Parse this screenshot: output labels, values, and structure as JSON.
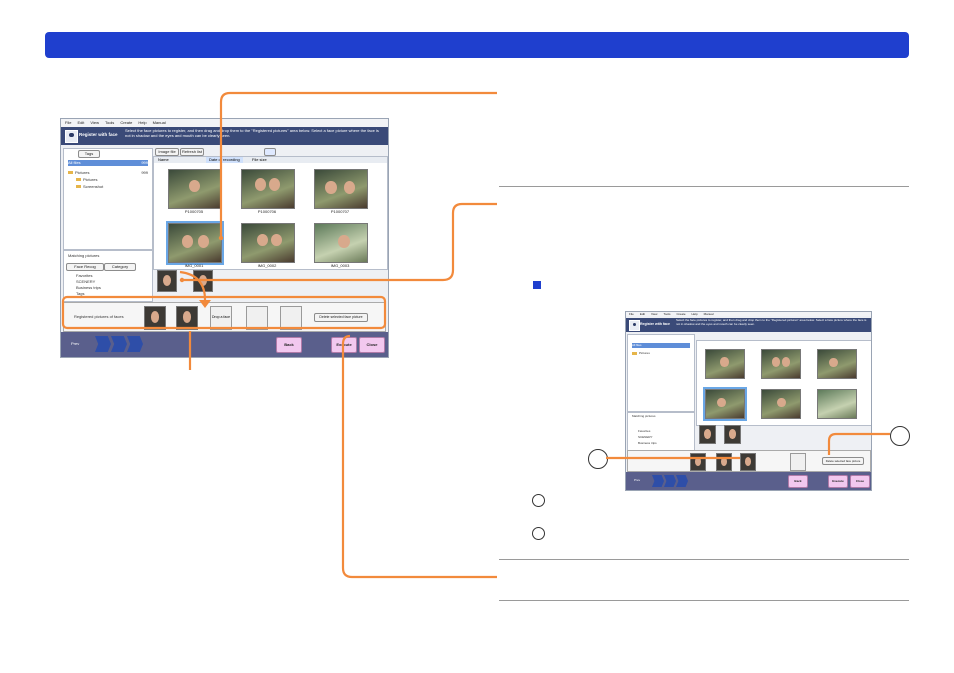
{
  "header": {
    "color": "#1f3fce"
  },
  "app": {
    "menu": [
      "File",
      "Edit",
      "View",
      "Tools",
      "Create",
      "Help",
      "Manual"
    ],
    "banner_title": "Register with face",
    "banner_instruction": "Select the face pictures to register, and then drag and drop them to the \"Registered pictures\" area below. Select a face picture where the face is not in shadow and the eyes and mouth can be clearly seen.",
    "tabs": {
      "tags": "Tags",
      "all": "All files"
    },
    "tree": [
      {
        "label": "All files",
        "count": "999"
      },
      {
        "label": "Pictures",
        "count": "999"
      },
      {
        "label": "Pictures",
        "count": "99"
      },
      {
        "label": "Screenshot",
        "count": "99"
      }
    ],
    "columns": {
      "name": "Name",
      "date": "Date of recording",
      "size": "File size"
    },
    "toolbar": {
      "b1": "Image file",
      "b2": "Refresh list"
    },
    "thumbnails": [
      "P1000705",
      "P1000706",
      "P1000707",
      "IMG_0001",
      "IMG_0002",
      "IMG_0003"
    ],
    "lower_tabs": {
      "people": "Face Recog",
      "category": "Category"
    },
    "matching": "Matching pictures",
    "categories": [
      "Favorites",
      "SCENERY",
      "Business trips",
      "Tags"
    ],
    "register": {
      "label": "Registered pictures of faces",
      "drop": "Drop a face",
      "delete": "Delete selected face picture"
    },
    "footer": {
      "prev": "Prev",
      "back": "Back",
      "execute": "Execute",
      "close": "Close"
    }
  },
  "callouts": {
    "one": "",
    "two": ""
  },
  "colors": {
    "accent": "#f28a3c",
    "banner": "#3a4a78",
    "footer": "#5a5f8c"
  }
}
